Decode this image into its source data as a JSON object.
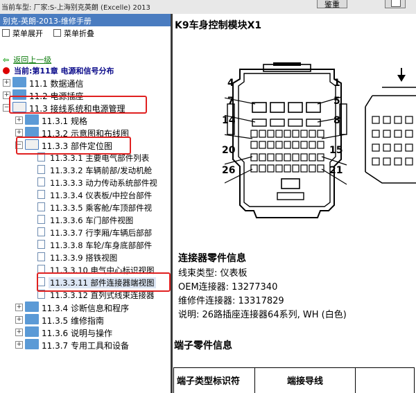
{
  "topbar": {
    "vehicle_label": "当前车型: 厂家:S-上海别克英朗 (Excelle) 2013",
    "button_text": "鉴重"
  },
  "left_panel": {
    "header": "别克-英朗-2013-维修手册",
    "expand_all": "菜单展开",
    "collapse_all": "菜单折叠",
    "back_link": "返回上一级",
    "current_chapter": "当前:第11章 电源和信号分布",
    "tree": [
      {
        "label": "11.1 数据通信"
      },
      {
        "label": "11.2 电源插座"
      },
      {
        "label": "11.3 接线系统和电源管理"
      },
      {
        "label": "11.3.1 规格"
      },
      {
        "label": "11.3.2 示意图和布线图"
      },
      {
        "label": "11.3.3 部件定位图"
      },
      {
        "label": "11.3.3.1 主要电气部件列表"
      },
      {
        "label": "11.3.3.2 车辆前部/发动机舱"
      },
      {
        "label": "11.3.3.3 动力传动系统部件视"
      },
      {
        "label": "11.3.3.4 仪表板/中控台部件"
      },
      {
        "label": "11.3.3.5 乘客舱/车顶部件视"
      },
      {
        "label": "11.3.3.6 车门部件视图"
      },
      {
        "label": "11.3.3.7 行李厢/车辆后部部"
      },
      {
        "label": "11.3.3.8 车轮/车身底部部件"
      },
      {
        "label": "11.3.3.9 搭铁视图"
      },
      {
        "label": "11.3.3.10 电气中心标识视图"
      },
      {
        "label": "11.3.3.11 部件连接器端视图"
      },
      {
        "label": "11.3.3.12 直列式线束连接器"
      },
      {
        "label": "11.3.4 诊断信息和程序"
      },
      {
        "label": "11.3.5 维修指南"
      },
      {
        "label": "11.3.6 说明与操作"
      },
      {
        "label": "11.3.7 专用工具和设备"
      }
    ]
  },
  "right_panel": {
    "module_title": "K9车身控制模块X1",
    "pin_labels": [
      "4",
      "1",
      "7",
      "5",
      "14",
      "8",
      "20",
      "15",
      "26",
      "21"
    ],
    "connector_info": {
      "heading": "连接器零件信息",
      "harness_type": "线束类型: 仪表板",
      "oem_connector": "OEM连接器: 13277340",
      "service_connector": "维修件连接器: 13317829",
      "description": "说明: 26路插座连接器64系列, WH (白色)"
    },
    "terminal_heading": "端子零件信息",
    "terminal_table": {
      "col1": "端子类型标识符",
      "col2": "端接导线"
    }
  },
  "colors": {
    "header_blue": "#4a7cc0",
    "folder_blue": "#5b9ad6",
    "highlight_red": "#e02020",
    "back_link_green": "#0a7a0a"
  }
}
